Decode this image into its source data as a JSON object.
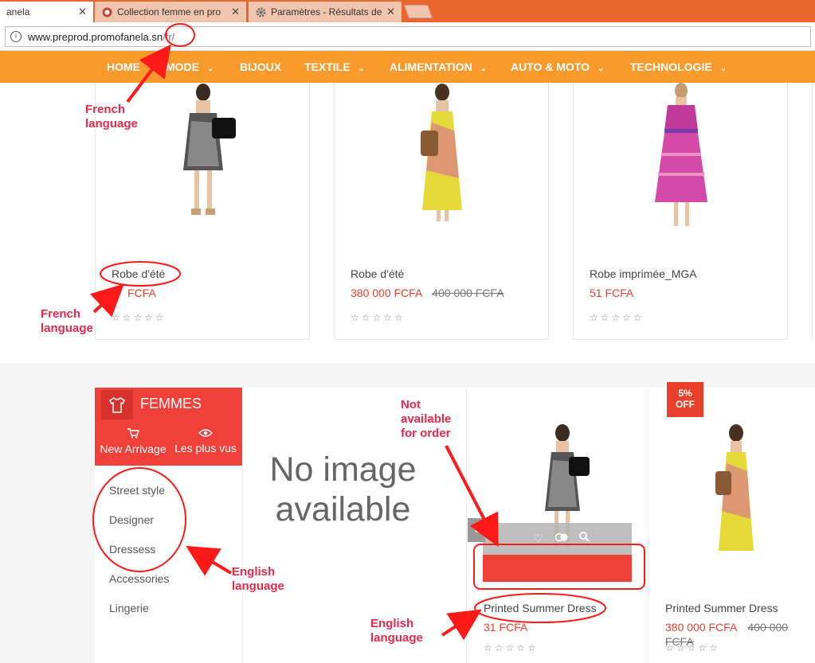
{
  "browser": {
    "tabs": [
      {
        "title": "anela",
        "active": true
      },
      {
        "title": "Collection femme en pro",
        "active": false
      },
      {
        "title": "Paramètres - Résultats de",
        "active": false
      }
    ],
    "close_glyph": "✕",
    "url_host": "www.preprod.promofanela.sn",
    "url_path": "/fr/"
  },
  "nav": {
    "items": [
      "HOME",
      "MODE",
      "BIJOUX",
      "TEXTILE",
      "ALIMENTATION",
      "AUTO & MOTO",
      "TECHNOLOGIE"
    ]
  },
  "top_products": [
    {
      "name": "Robe d'été",
      "price": "FCFA",
      "old_price": ""
    },
    {
      "name": "Robe d'été",
      "price": "380 000 FCFA",
      "old_price": "400 000 FCFA"
    },
    {
      "name": "Robe imprimée_MGA",
      "price": "51 FCFA",
      "old_price": ""
    }
  ],
  "stars": "☆☆☆☆☆",
  "femmes": {
    "title": "FEMMES",
    "link_new": "New Arrivage",
    "link_popular": "Les plus vus",
    "categories": [
      "Street style",
      "Designer",
      "Dressess",
      "Accessories",
      "Lingerie"
    ]
  },
  "no_image": {
    "line1": "No image",
    "line2": "available"
  },
  "bottom_products": [
    {
      "name": "Printed Summer Dress",
      "price": "31 FCFA",
      "old_price": ""
    },
    {
      "name": "Printed Summer Dress",
      "price": "380 000 FCFA",
      "old_price": "400 000",
      "old_price_2": "FCFA"
    }
  ],
  "badge": {
    "line1": "5%",
    "line2": "OFF"
  },
  "annotations": {
    "french1": [
      "French",
      "language"
    ],
    "french2": [
      "French",
      "language"
    ],
    "not_available": [
      "Not",
      "available",
      "for order"
    ],
    "english1": [
      "English",
      "language"
    ],
    "english2": [
      "English",
      "language"
    ]
  }
}
